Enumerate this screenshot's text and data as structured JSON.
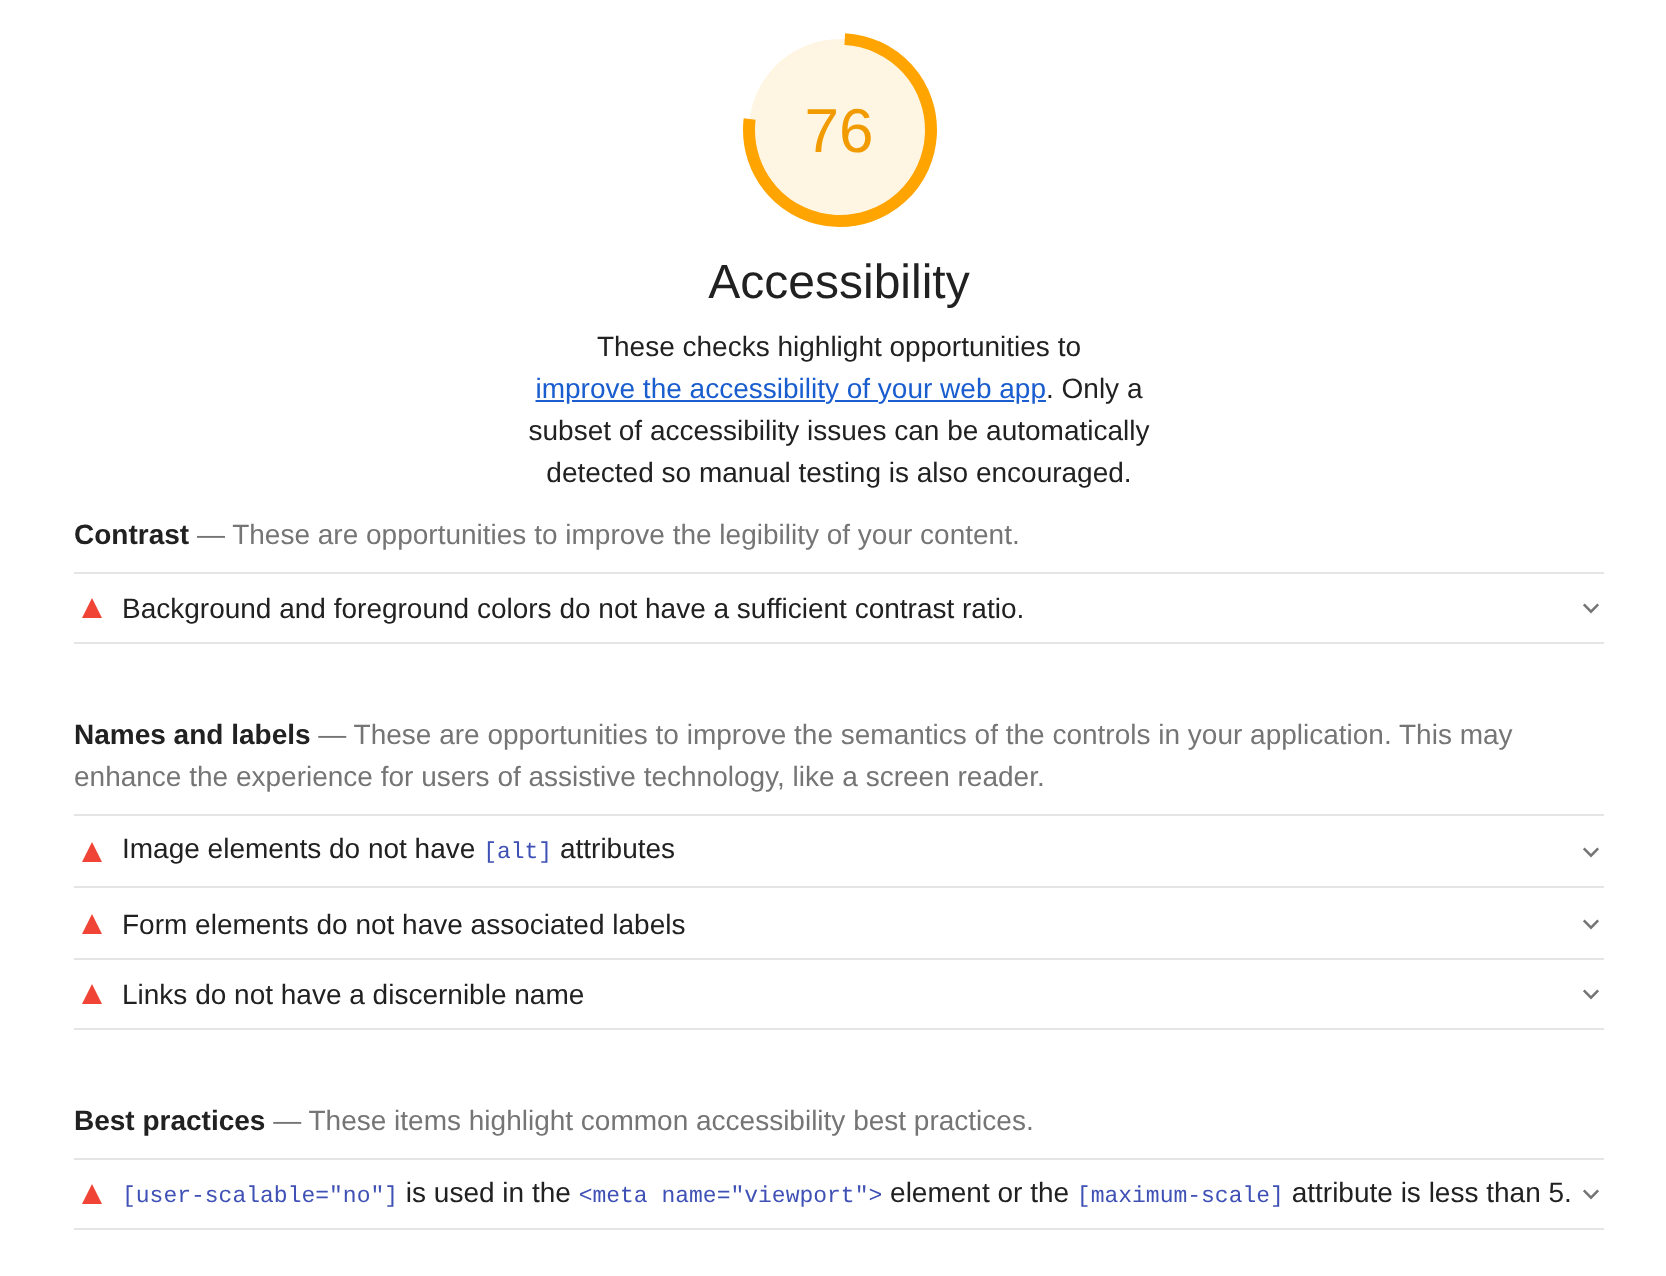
{
  "gauge": {
    "score": "76",
    "level": 0.76
  },
  "title": "Accessibility",
  "description": [
    {
      "kind": "text",
      "text": "These checks highlight opportunities to "
    },
    {
      "kind": "link",
      "text": "improve the accessibility of your web app"
    },
    {
      "kind": "text",
      "text": ". Only a subset of accessibility issues can be automatically detected so manual testing is also encouraged."
    }
  ],
  "groups": [
    {
      "title": "Contrast",
      "description": "— These are opportunities to improve the legibility of your content.",
      "audits": [
        {
          "failed": true,
          "expanded": false,
          "title": [
            {
              "kind": "text",
              "text": "Background and foreground colors do not have a sufficient contrast ratio."
            }
          ]
        }
      ]
    },
    {
      "title": "Names and labels",
      "description": "— These are opportunities to improve the semantics of the controls in your application. This may enhance the experience for users of assistive technology, like a screen reader.",
      "audits": [
        {
          "failed": true,
          "expanded": false,
          "title": [
            {
              "kind": "text",
              "text": "Image elements do not have "
            },
            {
              "kind": "code",
              "text": "[alt]"
            },
            {
              "kind": "text",
              "text": " attributes"
            }
          ]
        },
        {
          "failed": true,
          "expanded": false,
          "title": [
            {
              "kind": "text",
              "text": "Form elements do not have associated labels"
            }
          ]
        },
        {
          "failed": true,
          "expanded": false,
          "title": [
            {
              "kind": "text",
              "text": "Links do not have a discernible name"
            }
          ]
        }
      ]
    },
    {
      "title": "Best practices",
      "description": "— These items highlight common accessibility best practices.",
      "audits": [
        {
          "failed": true,
          "expanded": false,
          "title": [
            {
              "kind": "code",
              "text": "[user-scalable=\"no\"]"
            },
            {
              "kind": "text",
              "text": " is used in the "
            },
            {
              "kind": "code",
              "text": "<meta name=\"viewport\">"
            },
            {
              "kind": "text",
              "text": " element or the "
            },
            {
              "kind": "code",
              "text": "[maximum-scale]"
            },
            {
              "kind": "text",
              "text": " attribute is less than 5."
            }
          ]
        }
      ]
    }
  ]
}
